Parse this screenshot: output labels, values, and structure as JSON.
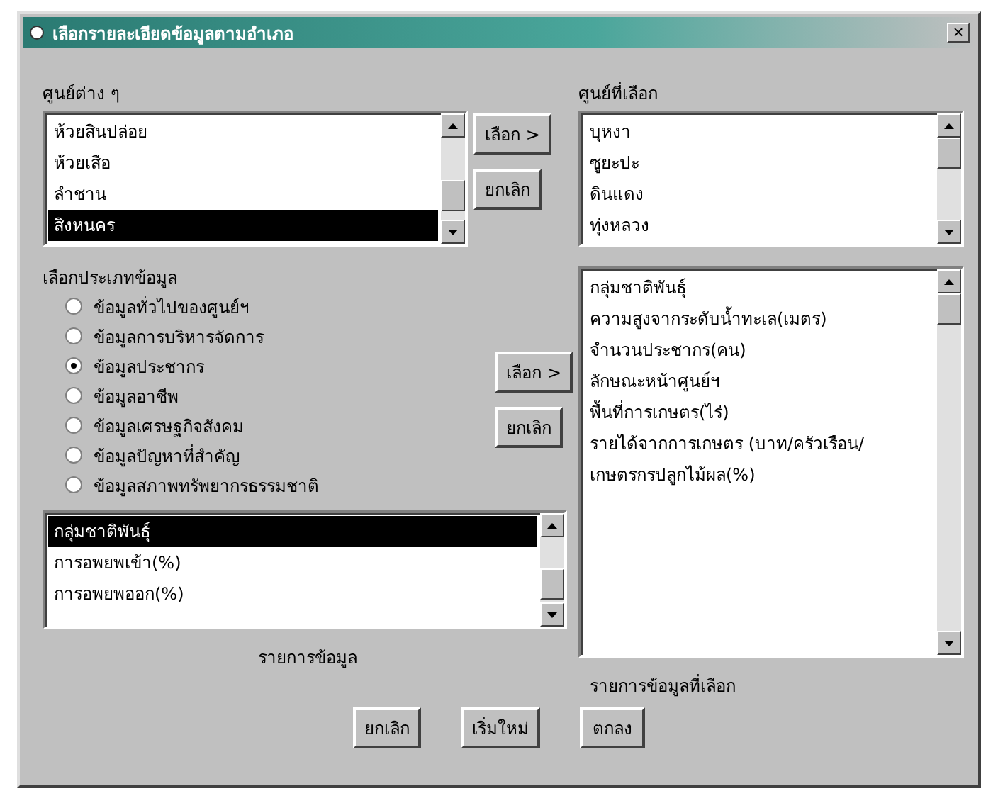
{
  "window": {
    "title": "เลือกรายละเอียดข้อมูลตามอำเภอ",
    "close": "×"
  },
  "centers": {
    "label": "ศูนย์ต่าง ๆ",
    "items": [
      {
        "label": "ห้วยสินปล่อย",
        "selected": false
      },
      {
        "label": "ห้วยเสือ",
        "selected": false
      },
      {
        "label": "ลำชาน",
        "selected": false
      },
      {
        "label": "สิงหนคร",
        "selected": true
      }
    ]
  },
  "center_buttons": [
    "เลือก >",
    "ยกเลิก"
  ],
  "selected_centers": {
    "label": "ศูนย์ที่เลือก",
    "items": [
      {
        "label": "บุหงา",
        "selected": false
      },
      {
        "label": "ซูยะปะ",
        "selected": false
      },
      {
        "label": "ดินแดง",
        "selected": false
      },
      {
        "label": "ทุ่งหลวง",
        "selected": false
      }
    ]
  },
  "data_type": {
    "label": "เลือกประเภทข้อมูล",
    "options": [
      {
        "label": "ข้อมูลทั่วไปของศูนย์ฯ",
        "selected": false
      },
      {
        "label": "ข้อมูลการบริหารจัดการ",
        "selected": false
      },
      {
        "label": "ข้อมูลประชากร",
        "selected": true
      },
      {
        "label": "ข้อมูลอาชีพ",
        "selected": false
      },
      {
        "label": "ข้อมูลเศรษฐกิจสังคม",
        "selected": false
      },
      {
        "label": "ข้อมูลปัญหาที่สำคัญ",
        "selected": false
      },
      {
        "label": "ข้อมูลสภาพทรัพยากรธรรมชาติ",
        "selected": false
      }
    ]
  },
  "item_buttons": [
    "เลือก >",
    "ยกเลิก"
  ],
  "items": {
    "label": "รายการข้อมูล",
    "items": [
      {
        "label": "กลุ่มชาติพันธุ์",
        "selected": true
      },
      {
        "label": "การอพยพเข้า(%)",
        "selected": false
      },
      {
        "label": "การอพยพออก(%)",
        "selected": false
      }
    ]
  },
  "selected_items": {
    "label": "รายการข้อมูลที่เลือก",
    "items": [
      {
        "label": "กลุ่มชาติพันธุ์",
        "selected": false
      },
      {
        "label": "ความสูงจากระดับน้ำทะเล(เมตร)",
        "selected": false
      },
      {
        "label": "จำนวนประชากร(คน)",
        "selected": false
      },
      {
        "label": "ลักษณะหน้าศูนย์ฯ",
        "selected": false
      },
      {
        "label": "พื้นที่การเกษตร(ไร่)",
        "selected": false
      },
      {
        "label": "รายได้จากการเกษตร (บาท/ครัวเรือน/",
        "selected": false
      },
      {
        "label": "เกษตรกรปลูกไม้ผล(%)",
        "selected": false
      }
    ]
  },
  "buttons": [
    "ยกเลิก",
    "เริ่มใหม่",
    "ตกลง"
  ]
}
